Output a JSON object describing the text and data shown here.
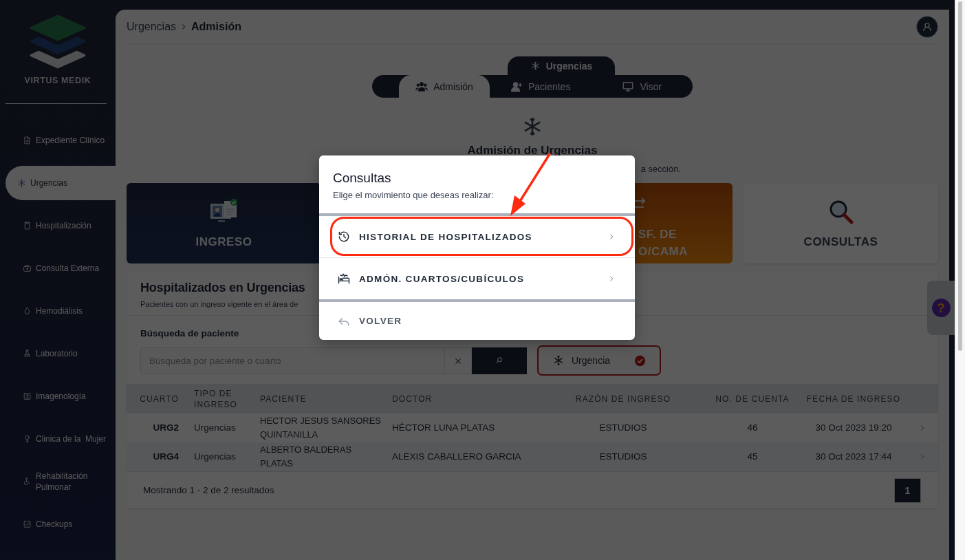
{
  "sidebar": {
    "brand": "VIRTUS MEDIK",
    "items": [
      {
        "label": "Expediente Clínico",
        "kind": "document",
        "selected": false
      },
      {
        "label": "Urgencias",
        "kind": "snowflake",
        "selected": true
      },
      {
        "label": "Hospitalización",
        "kind": "door",
        "selected": false
      },
      {
        "label": "Consulta Externa",
        "kind": "bag",
        "selected": false
      },
      {
        "label": "Hemodiálisis",
        "kind": "drop",
        "selected": false
      },
      {
        "label": "Laboratorio",
        "kind": "flask",
        "selected": false
      },
      {
        "label": "Imagenología",
        "kind": "scan",
        "selected": false
      },
      {
        "label": "Clinica de la  Mujer",
        "kind": "female",
        "selected": false
      },
      {
        "label": "Rehabilitación Pulmonar",
        "kind": "wheelchair",
        "selected": false
      },
      {
        "label": "Checkups",
        "kind": "checkbox",
        "selected": false
      }
    ]
  },
  "breadcrumb": [
    "Urgencias",
    "Admisión"
  ],
  "module_tab": "Urgencias",
  "tabs": [
    {
      "label": "Admisión",
      "kind": "people",
      "selected": true
    },
    {
      "label": "Pacientes",
      "kind": "adduser",
      "selected": false
    },
    {
      "label": "Visor",
      "kind": "monitor",
      "selected": false
    }
  ],
  "hero": {
    "title": "Admisión de Urgencias",
    "subtitle": "a sección."
  },
  "cards": [
    {
      "kind": "ingreso",
      "lines": [
        "INGRESO"
      ]
    },
    {
      "kind": "hidden"
    },
    {
      "kind": "transfer",
      "lines": [
        "SF. DE",
        "O/CAMA"
      ]
    },
    {
      "kind": "consultas",
      "lines": [
        "CONSULTAS"
      ]
    }
  ],
  "panel": {
    "title": "Hospitalizados en Urgencias",
    "subtitle": "Pacientes con un ingreso vigente en el área de",
    "search_label": "Búsqueda de paciente",
    "search_placeholder": "Búsqueda por paciente o cuarto",
    "filter": {
      "label": "Urgencia",
      "checked": true
    }
  },
  "table": {
    "columns": [
      "CUARTO",
      "TIPO DE INGRESO",
      "PACIENTE",
      "DOCTOR",
      "RAZÓN DE INGRESO",
      "NO. DE CUENTA",
      "FECHA DE INGRESO"
    ],
    "rows": [
      {
        "cells": [
          "URG2",
          "Urgencias",
          "HECTOR JESUS SANSORES QUINTANILLA",
          "HÉCTOR LUNA PLATAS",
          "ESTUDIOS",
          "46",
          "30 Oct 2023 19:20"
        ]
      },
      {
        "cells": [
          "URG4",
          "Urgencias",
          "ALBERTO BALDERAS PLATAS",
          "ALEXIS CABALLERO GARCIA",
          "ESTUDIOS",
          "45",
          "30 Oct 2023 17:44"
        ]
      }
    ]
  },
  "footer": {
    "summary": "Mostrando 1 - 2 de 2 resultados",
    "pages": [
      {
        "label": "1",
        "selected": true
      }
    ]
  },
  "help_button": "?",
  "dialog": {
    "title": "Consultas",
    "subtitle": "Elige el movimiento que deseas realizar:",
    "options": [
      {
        "kind": "history",
        "label": "HISTORIAL DE HOSPITALIZADOS",
        "highlighted": true
      },
      {
        "kind": "rooms",
        "label": "ADMÓN. CUARTOS/CUBÍCULOS",
        "highlighted": false
      },
      {
        "kind": "back",
        "label": "VOLVER",
        "highlighted": false
      }
    ]
  }
}
